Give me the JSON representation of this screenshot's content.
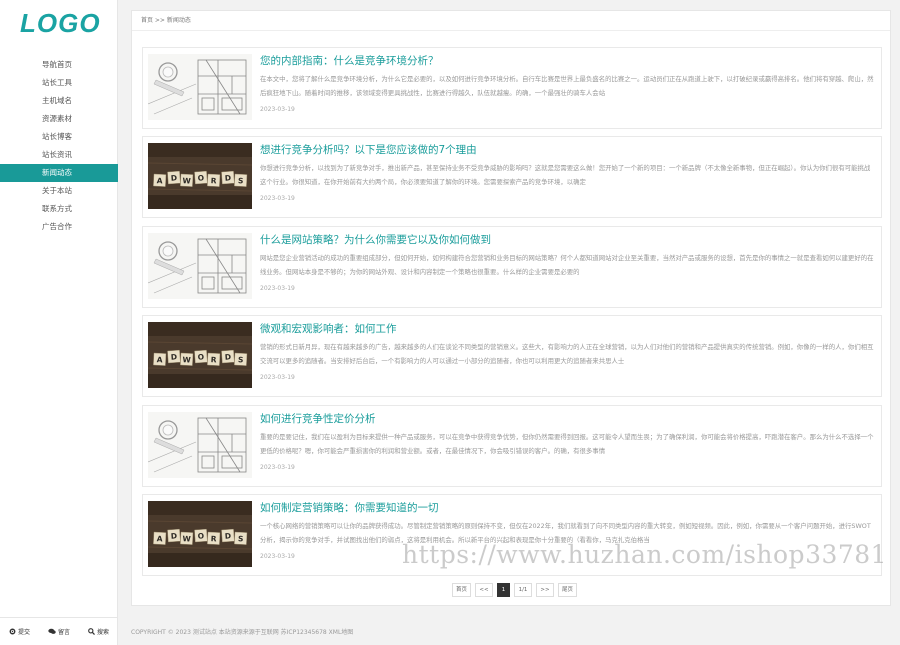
{
  "sidebar": {
    "logo": "LOGO",
    "nav": [
      "导航首页",
      "站长工具",
      "主机域名",
      "资源素材",
      "站长博客",
      "站长资讯",
      "新闻动态",
      "关于本站",
      "联系方式",
      "广告合作"
    ],
    "footer": [
      {
        "icon": "gear-icon",
        "label": "提交"
      },
      {
        "icon": "comments-icon",
        "label": "留言"
      },
      {
        "icon": "search-icon",
        "label": "搜索"
      }
    ]
  },
  "breadcrumb": "首页 >> 新闻动态",
  "articles": [
    {
      "title": "您的内部指南：什么是竞争环境分析？",
      "summary": "在本文中，您将了解什么是竞争环境分析，为什么它是必要的，以及如何进行竞争环境分析。自行车比赛是世界上最负盛名的比赛之一。运动员们正在从跑道上驶下，以打破纪录或赢得高排名。他们将有穿越、爬山，然后疯狂地下山。随着时间的推移，该领域变得更具挑战性，比赛进行得越久，队伍就越瘦。的确，一个最强壮的骑车人会站",
      "date": "2023-03-19",
      "thumb": "plan"
    },
    {
      "title": "想进行竞争分析吗？以下是您应该做的7个理由",
      "summary": "你想进行竞争分析，以找到为了新竞争对手，推出新产品，甚至保持业务不受竞争威胁的影响吗？这就是您需要这么做！您开始了一个新的项目：一个新品牌（不太像全新事物，但正在崛起）。你认为你们很有可能挑战这个行业。你很知道，在你开始前有大约两个局，你必须要知道了解你的环境。您需要探索产品的竞争环境，以确定",
      "date": "2023-03-19",
      "thumb": "adwords"
    },
    {
      "title": "什么是网站策略？为什么你需要它以及你如何做到",
      "summary": "网站是您企业营销活动的成功的重要组成部分，但如何开始，如何构建符合您营销和业务目标的网站策略？何个人都知道网站对企业至关重要，当然对产品或服务的设想，首先是你的事情之一就是查看如何以建更好的在线业务。但网站本身是不够的；为你的网站外观、设计和内容制定一个策略也很重要。什么样的企业需要是必要的",
      "date": "2023-03-19",
      "thumb": "plan"
    },
    {
      "title": "微观和宏观影响者：如何工作",
      "summary": "营销的形式日新月异，现在有越来越多的广告，越来越多的人们在谈论不同类型的营销意义。这些大，有影响力的人正在全球营销，以为人们对他们的营销和产品提供真实的传统营销。例如，你像的一样的人，你们相互交流可以更多的追随者。当安排好后台后，一个有影响力的人可以通过一小部分的追随者，你也可以利用更大的追随者来共思人士",
      "date": "2023-03-19",
      "thumb": "adwords"
    },
    {
      "title": "如何进行竞争性定价分析",
      "summary": "重要的是要记住，我们在以盈利为目标来提供一种产品或服务，可以在竞争中获得竞争优势，但你仍然需要得到回报。这可能令人望而生畏；为了确保利润，你可能会将价格提高，吓跑潜在客户。那么为什么不选择一个更低的价格呢？嗯，你可能会严重损害你的利润和营业额。或者，在最佳情况下，你会吸引错误的客户。的确，有很多事情",
      "date": "2023-03-19",
      "thumb": "plan"
    },
    {
      "title": "如何制定营销策略：你需要知道的一切",
      "summary": "一个核心网络的营销策略可以让你的品牌获得成功。尽管制定营销策略的原则保持不变，但仅在2022年，我们就看到了向不同类型内容的重大转变，例如短视频。因此，例如，你需要从一个客户问题开始，进行SWOT分析，揭示你的竞争对手，并试图找出他们的弱点，这将是利用机会。所以新平台的兴起和表现是你十分重要的（看看你，马克扎克伯格当",
      "date": "2023-03-19",
      "thumb": "adwords"
    }
  ],
  "pagination": [
    "首页",
    "<<",
    "1",
    "1/1",
    ">>",
    "尾页"
  ],
  "footer_text": "COPYRIGHT © 2023 测试站点 本站资源来源于互联网 苏ICP12345678 XML地图",
  "watermark": "https://www.huzhan.com/ishop33781",
  "colors": {
    "accent": "#1a9d9b",
    "active_nav": "#199a98"
  }
}
